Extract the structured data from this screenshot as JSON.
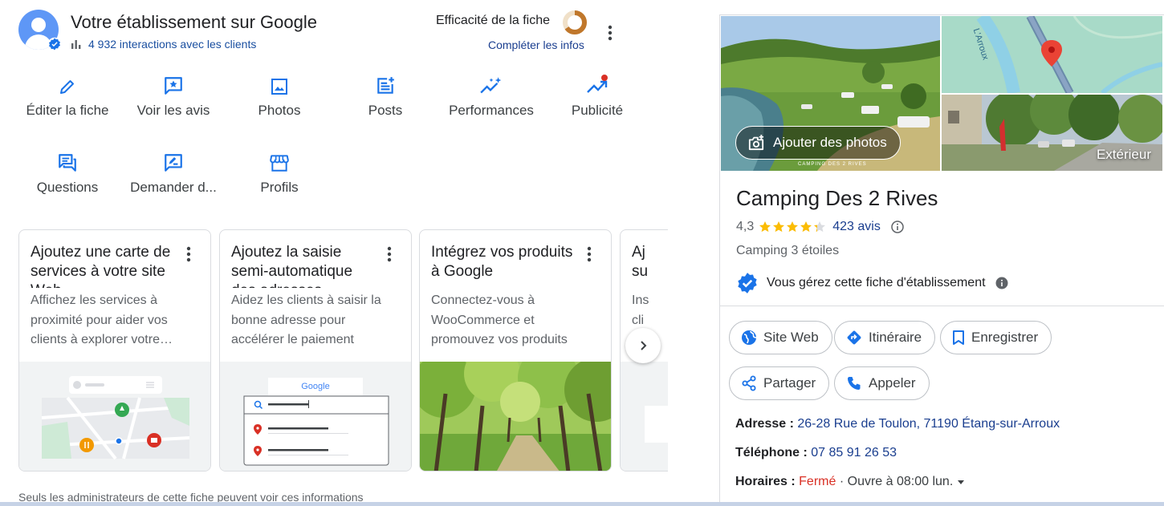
{
  "header": {
    "title": "Votre établissement sur Google",
    "interactions": "4 932 interactions avec les clients",
    "efficacite_label": "Efficacité de la fiche",
    "completer_link": "Compléter les infos",
    "profile_completion": 0.65
  },
  "actions": [
    {
      "label": "Éditer la fiche",
      "icon": "pencil-icon"
    },
    {
      "label": "Voir les avis",
      "icon": "star-review-icon"
    },
    {
      "label": "Photos",
      "icon": "photo-icon"
    },
    {
      "label": "Posts",
      "icon": "post-add-icon"
    },
    {
      "label": "Performances",
      "icon": "trending-sparkle-icon"
    },
    {
      "label": "Publicité",
      "icon": "trending-up-icon"
    },
    {
      "label": "Questions",
      "icon": "forum-icon"
    },
    {
      "label": "Demander d...",
      "icon": "rate-review-icon"
    },
    {
      "label": "Profils",
      "icon": "storefront-icon"
    }
  ],
  "cards": [
    {
      "title": "Ajoutez une carte de services à votre site Web",
      "desc": "Affichez les services à proximité pour aider vos clients à explorer votre…",
      "image": "map-services-illustration"
    },
    {
      "title": "Ajoutez la saisie semi-automatique des adresses",
      "desc": "Aidez les clients à saisir la bonne adresse pour accélérer le paiement",
      "image": "google-autocomplete-illustration",
      "image_text": "Google"
    },
    {
      "title": "Intégrez vos produits à Google",
      "desc": "Connectez-vous à WooCommerce et promouvez vos produits",
      "image": "tree-alley-photo"
    },
    {
      "title": "Aj su",
      "desc": "Ins cli",
      "image": "partial-illustration"
    }
  ],
  "admin_note": "Seuls les administrateurs de cette fiche peuvent voir ces informations",
  "business": {
    "add_photos": "Ajouter des photos",
    "exterior_label": "Extérieur",
    "map_river_label": "L'Arroux",
    "photo_watermark": "CAMPING DES 2 RIVES",
    "name": "Camping Des 2 Rives",
    "rating": "4,3",
    "stars": 4.3,
    "reviews": "423 avis",
    "category": "Camping 3 étoiles",
    "managed_text": "Vous gérez cette fiche d'établissement",
    "buttons": {
      "site": "Site Web",
      "itineraire": "Itinéraire",
      "enregistrer": "Enregistrer",
      "partager": "Partager",
      "appeler": "Appeler"
    },
    "address_label": "Adresse :",
    "address": "26-28 Rue de Toulon, 71190 Étang-sur-Arroux",
    "phone_label": "Téléphone :",
    "phone": "07 85 91 26 53",
    "hours_label": "Horaires :",
    "hours_status": "Fermé",
    "hours_sep": "·",
    "hours_next": "Ouvre à 08:00 lun."
  },
  "colors": {
    "accent_blue": "#1a73e8",
    "link_blue": "#1a3e8f",
    "closed_red": "#d93025",
    "star_yellow": "#fbbc04"
  }
}
